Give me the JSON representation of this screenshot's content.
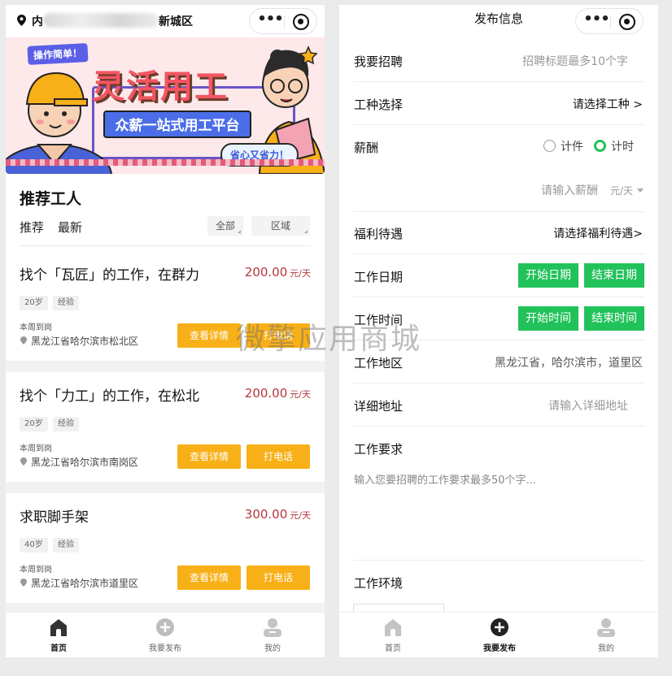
{
  "left": {
    "location": {
      "prefix": "内",
      "city": "新城区"
    },
    "banner": {
      "tag": "操作简单！",
      "title": "灵活用工",
      "subtitle": "众薪一站式用工平台",
      "bubble": "省心又省力！"
    },
    "section_title": "推荐工人",
    "tabs": [
      "推荐",
      "最新"
    ],
    "filters": [
      "全部",
      "区域"
    ],
    "jobs": [
      {
        "title": "找个「瓦匠」的工作，在群力",
        "salary": "200.00",
        "unit": "元/天",
        "age": "20岁",
        "exp": "经验",
        "when": "本周到岗",
        "address": "黑龙江省哈尔滨市松北区",
        "detail_btn": "查看详情",
        "call_btn": "打电话"
      },
      {
        "title": "找个「力工」的工作，在松北",
        "salary": "200.00",
        "unit": "元/天",
        "age": "20岁",
        "exp": "经验",
        "when": "本周到岗",
        "address": "黑龙江省哈尔滨市南岗区",
        "detail_btn": "查看详情",
        "call_btn": "打电话"
      },
      {
        "title": "求职脚手架",
        "salary": "300.00",
        "unit": "元/天",
        "age": "40岁",
        "exp": "经验",
        "when": "本周到岗",
        "address": "黑龙江省哈尔滨市道里区",
        "detail_btn": "查看详情",
        "call_btn": "打电话"
      }
    ],
    "tabbar": [
      {
        "label": "首页",
        "icon": "home-icon",
        "active": true
      },
      {
        "label": "我要发布",
        "icon": "plus-circle-icon",
        "active": false
      },
      {
        "label": "我的",
        "icon": "user-icon",
        "active": false
      }
    ]
  },
  "right": {
    "title": "发布信息",
    "fields": {
      "recruit": {
        "label": "我要招聘",
        "placeholder": "招聘标题最多10个字"
      },
      "job_type": {
        "label": "工种选择",
        "value": "请选择工种 >"
      },
      "salary": {
        "label": "薪酬",
        "option_piece": "计件",
        "option_time": "计时",
        "selected": "计时",
        "input_placeholder": "请输入薪酬",
        "unit": "元/天"
      },
      "welfare": {
        "label": "福利待遇",
        "value": "请选择福利待遇>"
      },
      "work_date": {
        "label": "工作日期",
        "start": "开始日期",
        "end": "结束日期"
      },
      "work_time": {
        "label": "工作时间",
        "start": "开始时间",
        "end": "结束时间"
      },
      "region": {
        "label": "工作地区",
        "value": "黑龙江省，哈尔滨市，道里区"
      },
      "address": {
        "label": "详细地址",
        "placeholder": "请输入详细地址"
      },
      "requirement": {
        "label": "工作要求",
        "placeholder": "输入您要招聘的工作要求最多50个字..."
      },
      "environment": {
        "label": "工作环境"
      }
    },
    "tabbar": [
      {
        "label": "首页",
        "icon": "home-icon",
        "active": false
      },
      {
        "label": "我要发布",
        "icon": "plus-circle-icon",
        "active": true
      },
      {
        "label": "我的",
        "icon": "user-icon",
        "active": false
      }
    ]
  },
  "watermark": "微擎应用商城",
  "colors": {
    "accent_orange": "#f8b018",
    "accent_green": "#22c25a",
    "salary_red": "#b5373c"
  }
}
